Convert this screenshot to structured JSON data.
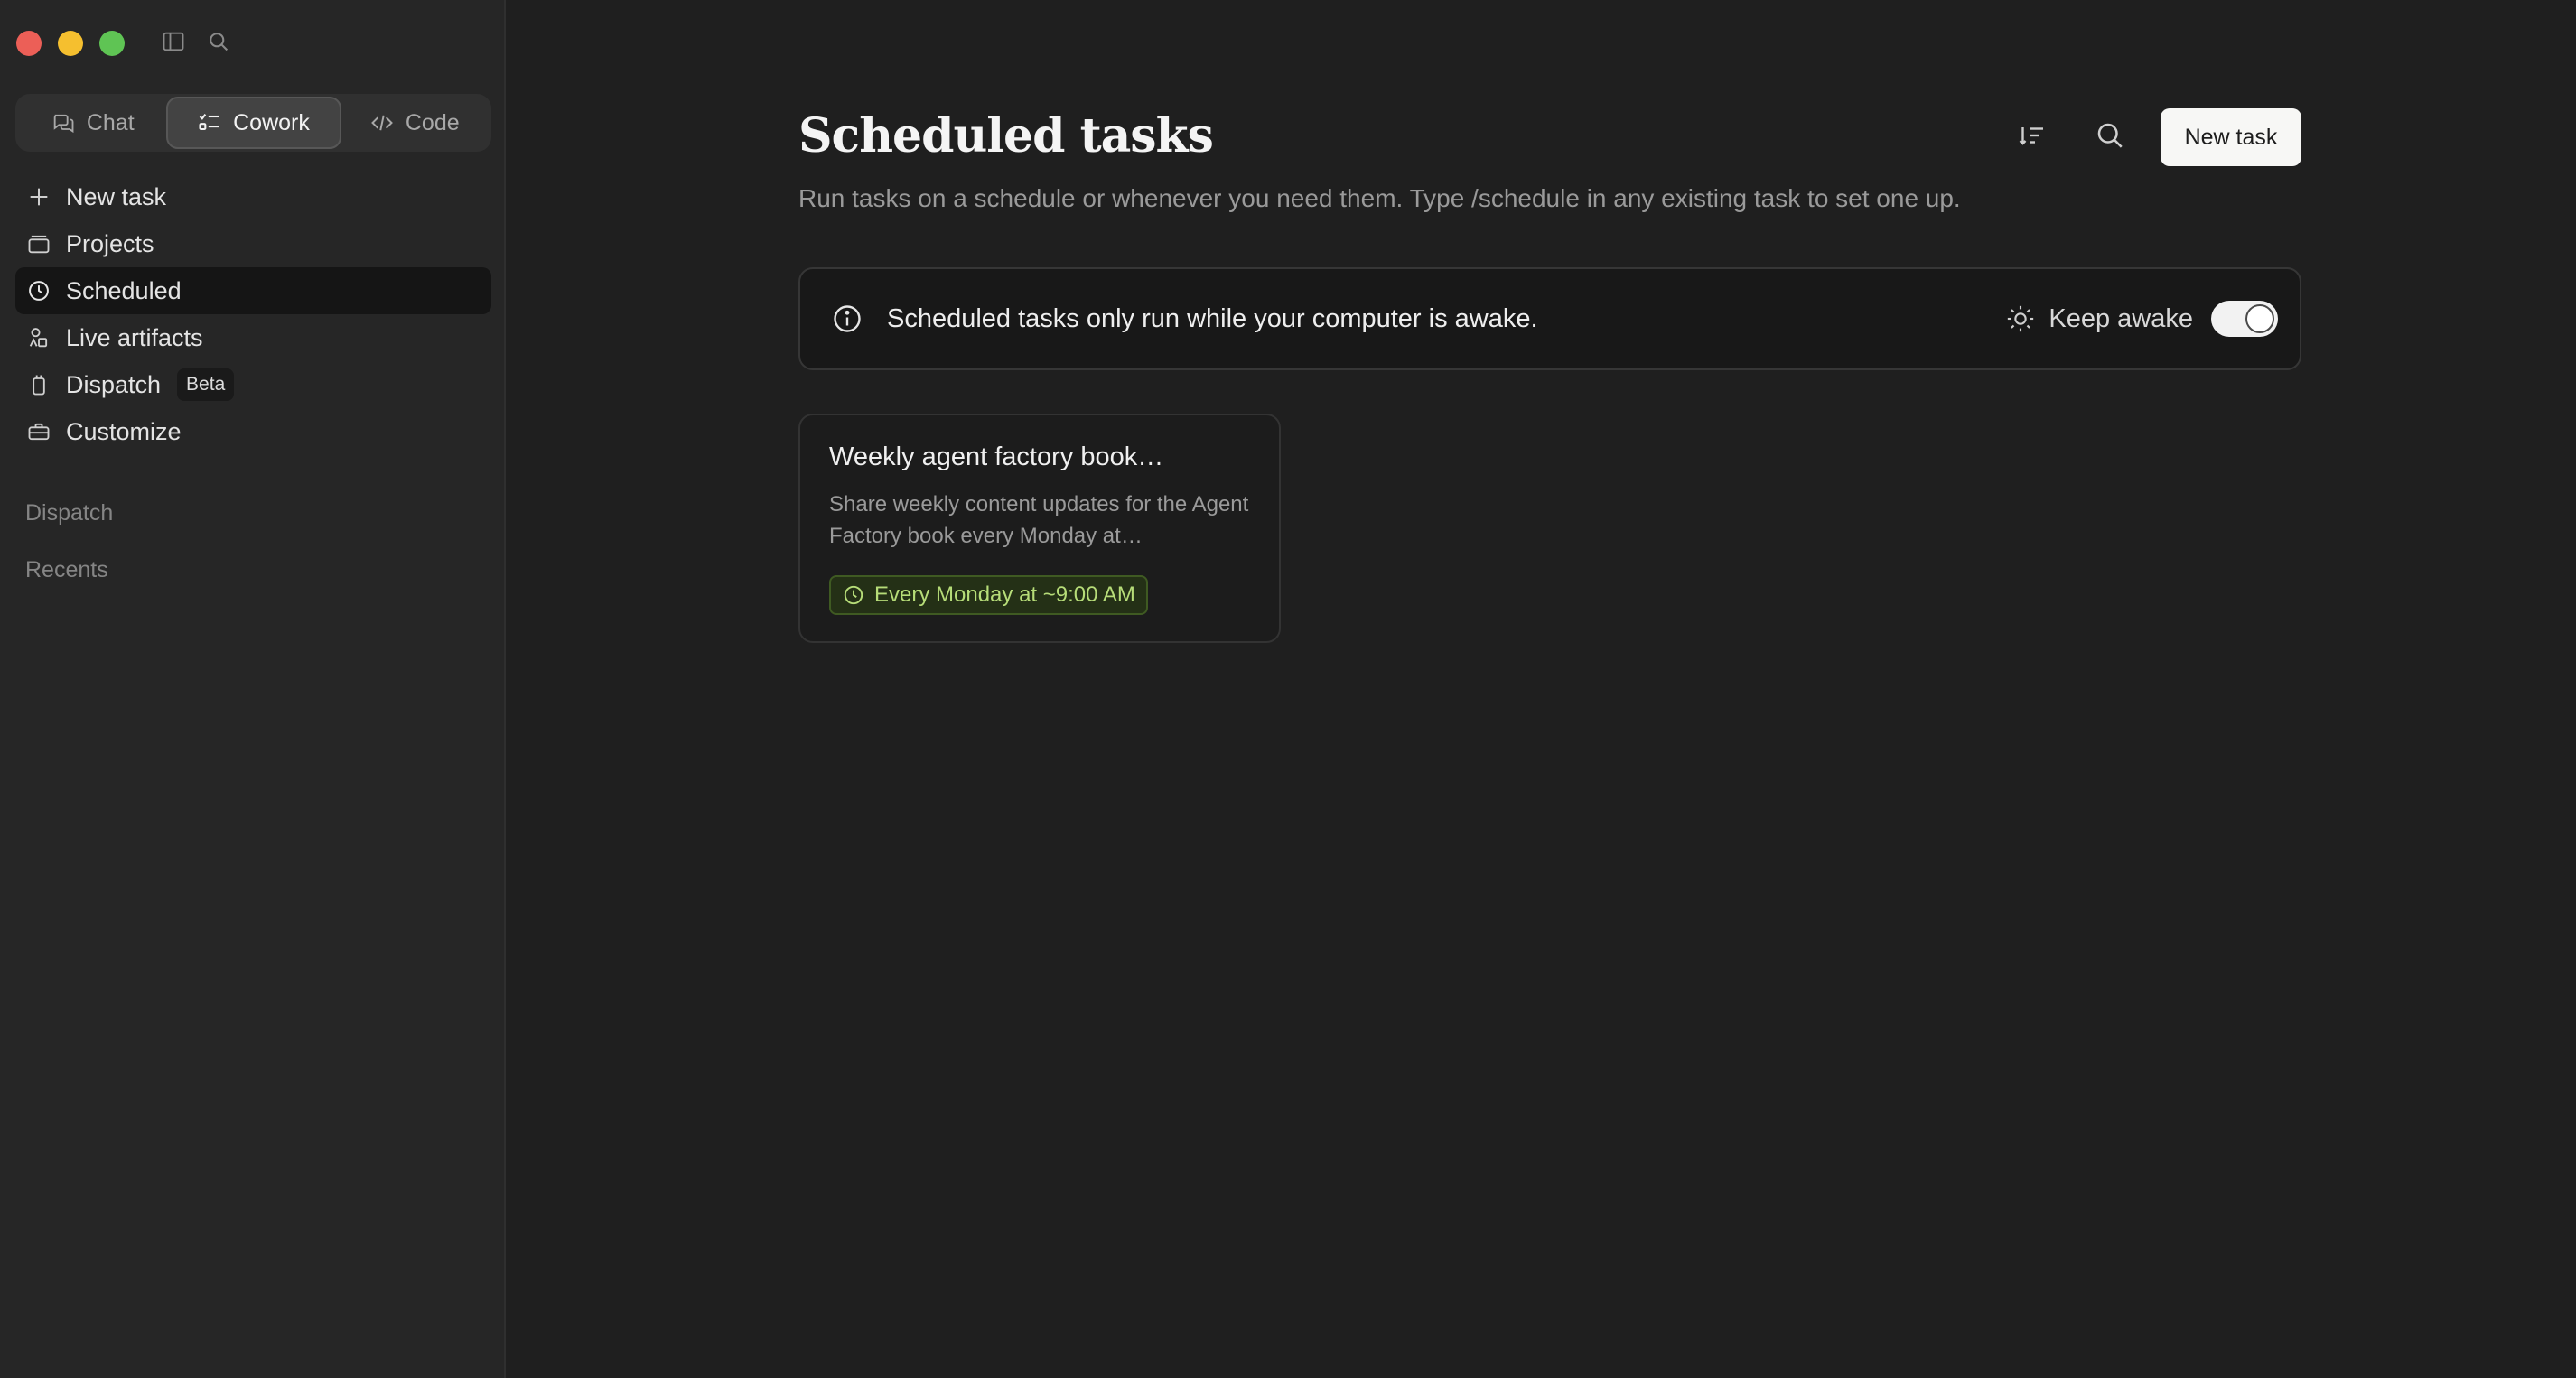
{
  "sidebar": {
    "modes": [
      {
        "label": "Chat",
        "icon": "chat-bubbles-icon"
      },
      {
        "label": "Cowork",
        "icon": "checklist-icon"
      },
      {
        "label": "Code",
        "icon": "code-icon"
      }
    ],
    "active_mode": "Cowork",
    "items": [
      {
        "label": "New task",
        "icon": "plus-icon"
      },
      {
        "label": "Projects",
        "icon": "folder-icon"
      },
      {
        "label": "Scheduled",
        "icon": "clock-icon"
      },
      {
        "label": "Live artifacts",
        "icon": "shapes-icon"
      },
      {
        "label": "Dispatch",
        "icon": "phone-icon",
        "badge": "Beta"
      },
      {
        "label": "Customize",
        "icon": "briefcase-icon"
      }
    ],
    "active_item": "Scheduled",
    "sections": [
      "Dispatch",
      "Recents"
    ]
  },
  "page": {
    "title": "Scheduled tasks",
    "subtitle": "Run tasks on a schedule or whenever you need them. Type /schedule in any existing task to set one up.",
    "new_task_label": "New task"
  },
  "banner": {
    "text": "Scheduled tasks only run while your computer is awake.",
    "keep_awake_label": "Keep awake",
    "keep_awake_on": true
  },
  "tasks": [
    {
      "title": "Weekly agent factory book…",
      "description": "Share weekly content updates for the Agent Factory book every Monday at…",
      "schedule": "Every Monday at ~9:00 AM"
    }
  ],
  "colors": {
    "background": "#1f1f1f",
    "sidebar": "#262626",
    "schedule_accent": "#b6dc78",
    "button_bg": "#f7f7f5"
  }
}
